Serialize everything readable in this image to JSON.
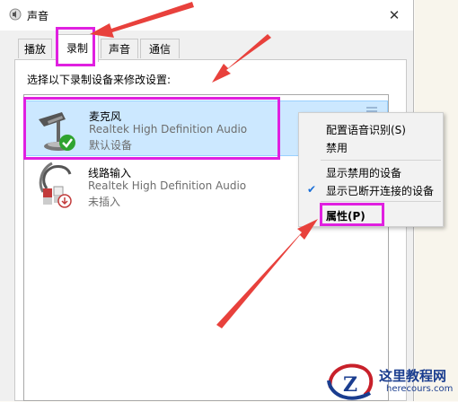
{
  "window": {
    "title": "声音",
    "close_glyph": "✕"
  },
  "tabs": [
    {
      "label": "播放"
    },
    {
      "label": "录制",
      "active": true
    },
    {
      "label": "声音"
    },
    {
      "label": "通信"
    }
  ],
  "instruction": "选择以下录制设备来修改设置:",
  "devices": [
    {
      "name": "麦克风",
      "driver": "Realtek High Definition Audio",
      "status": "默认设备",
      "icon": "microphone-icon",
      "selected": true
    },
    {
      "name": "线路输入",
      "driver": "Realtek High Definition Audio",
      "status": "未插入",
      "icon": "line-in-icon",
      "selected": false
    }
  ],
  "context_menu": {
    "items": [
      {
        "label": "配置语音识别(S)"
      },
      {
        "label": "禁用"
      },
      {
        "label": "显示禁用的设备"
      },
      {
        "label": "显示已断开连接的设备",
        "checked": true
      },
      {
        "label": "属性(P)",
        "bold": true
      }
    ]
  },
  "watermark": {
    "text": "这里教程网",
    "url": "herecours.com"
  },
  "colors": {
    "highlight": "#e020e0",
    "arrow": "#e8413c",
    "selection": "#cce8ff"
  }
}
